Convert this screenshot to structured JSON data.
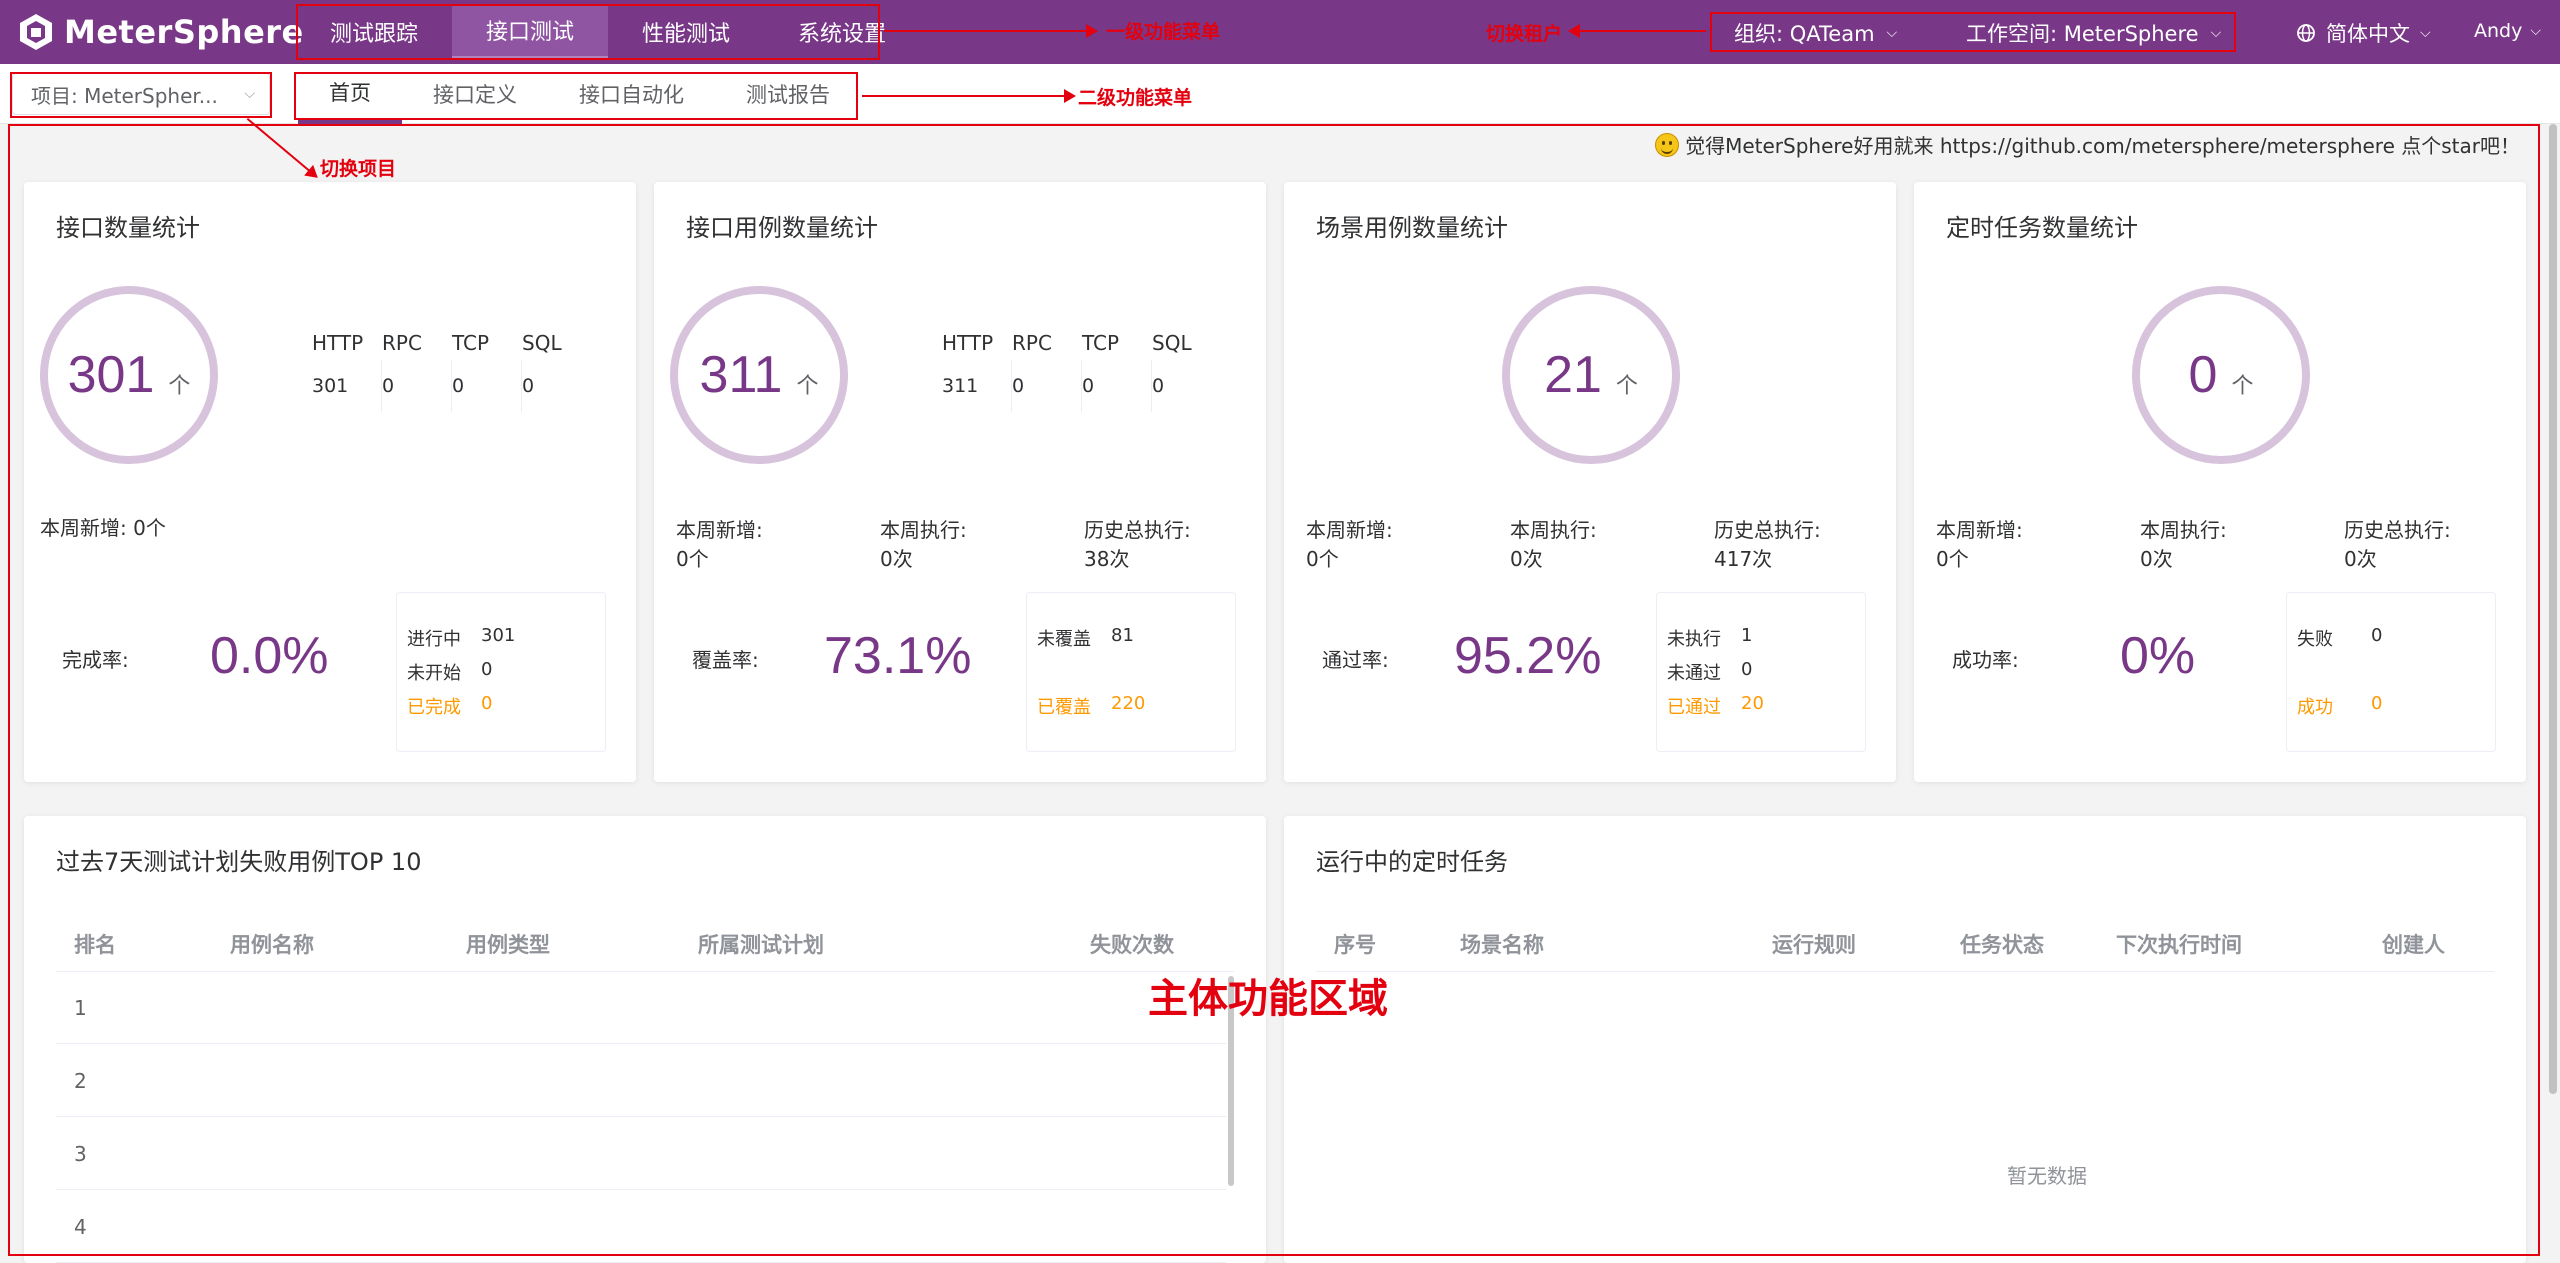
{
  "app": {
    "name": "MeterSphere"
  },
  "main_menu": [
    {
      "label": "测试跟踪",
      "active": false
    },
    {
      "label": "接口测试",
      "active": true
    },
    {
      "label": "性能测试",
      "active": false
    },
    {
      "label": "系统设置",
      "active": false
    }
  ],
  "header_right": {
    "organization": "组织: QATeam",
    "workspace": "工作空间: MeterSphere",
    "language": "简体中文",
    "user": "Andy",
    "globe_icon": "globe-icon",
    "caret_icon": "chevron-down-icon"
  },
  "project_select": {
    "value": "项目: MeterSpher..."
  },
  "sub_menu": [
    {
      "label": "首页",
      "active": true
    },
    {
      "label": "接口定义",
      "active": false
    },
    {
      "label": "接口自动化",
      "active": false
    },
    {
      "label": "测试报告",
      "active": false
    }
  ],
  "star_note": "觉得MeterSphere好用就来 https://github.com/metersphere/metersphere 点个star吧！",
  "cards": {
    "api": {
      "title": "接口数量统计",
      "count": "301",
      "unit": "个",
      "protocol_headers": [
        "HTTP",
        "RPC",
        "TCP",
        "SQL"
      ],
      "protocol_values": [
        "301",
        "0",
        "0",
        "0"
      ],
      "week_new": "本周新增: 0个",
      "rate_label": "完成率:",
      "rate_value": "0.0%",
      "detail": [
        {
          "label": "进行中",
          "value": "301"
        },
        {
          "label": "未开始",
          "value": "0"
        },
        {
          "label": "已完成",
          "value": "0"
        }
      ]
    },
    "case": {
      "title": "接口用例数量统计",
      "count": "311",
      "unit": "个",
      "protocol_headers": [
        "HTTP",
        "RPC",
        "TCP",
        "SQL"
      ],
      "protocol_values": [
        "311",
        "0",
        "0",
        "0"
      ],
      "stats": [
        {
          "label": "本周新增:",
          "value": "0个"
        },
        {
          "label": "本周执行:",
          "value": "0次"
        },
        {
          "label": "历史总执行:",
          "value": "38次"
        }
      ],
      "rate_label": "覆盖率:",
      "rate_value": "73.1%",
      "detail": [
        {
          "label": "未覆盖",
          "value": "81"
        },
        {
          "label": "已覆盖",
          "value": "220"
        }
      ]
    },
    "scenario": {
      "title": "场景用例数量统计",
      "count": "21",
      "unit": "个",
      "stats": [
        {
          "label": "本周新增:",
          "value": "0个"
        },
        {
          "label": "本周执行:",
          "value": "0次"
        },
        {
          "label": "历史总执行:",
          "value": "417次"
        }
      ],
      "rate_label": "通过率:",
      "rate_value": "95.2%",
      "detail": [
        {
          "label": "未执行",
          "value": "1"
        },
        {
          "label": "未通过",
          "value": "0"
        },
        {
          "label": "已通过",
          "value": "20"
        }
      ]
    },
    "schedule": {
      "title": "定时任务数量统计",
      "count": "0",
      "unit": "个",
      "stats": [
        {
          "label": "本周新增:",
          "value": "0个"
        },
        {
          "label": "本周执行:",
          "value": "0次"
        },
        {
          "label": "历史总执行:",
          "value": "0次"
        }
      ],
      "rate_label": "成功率:",
      "rate_value": "0%",
      "detail": [
        {
          "label": "失败",
          "value": "0"
        },
        {
          "label": "成功",
          "value": "0"
        }
      ]
    }
  },
  "failure_top10": {
    "title": "过去7天测试计划失败用例TOP 10",
    "columns": [
      "排名",
      "用例名称",
      "用例类型",
      "所属测试计划",
      "失败次数"
    ],
    "rows": [
      "1",
      "2",
      "3",
      "4"
    ]
  },
  "running_schedule": {
    "title": "运行中的定时任务",
    "columns": [
      "序号",
      "场景名称",
      "运行规则",
      "任务状态",
      "下次执行时间",
      "创建人"
    ],
    "empty_text": "暂无数据"
  },
  "annotations": {
    "level1_menu": "一级功能菜单",
    "switch_tenant": "切换租户",
    "level2_menu": "二级功能菜单",
    "switch_project": "切换项目",
    "main_area": "主体功能区域"
  },
  "colors": {
    "brand": "#783887",
    "header_bg": "#783887",
    "ring": "#d7c3dc",
    "orange": "#ff9900",
    "annotation_red": "#e3000f"
  }
}
